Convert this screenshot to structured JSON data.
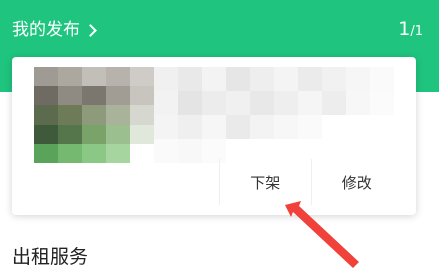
{
  "header": {
    "title": "我的发布",
    "page_current": "1",
    "page_total": "/1",
    "bg_color": "#1fc57f"
  },
  "card": {
    "actions": {
      "unlist_label": "下架",
      "edit_label": "修改"
    }
  },
  "section": {
    "title": "出租服务"
  },
  "annotation": {
    "arrow_color": "#f0413a"
  }
}
